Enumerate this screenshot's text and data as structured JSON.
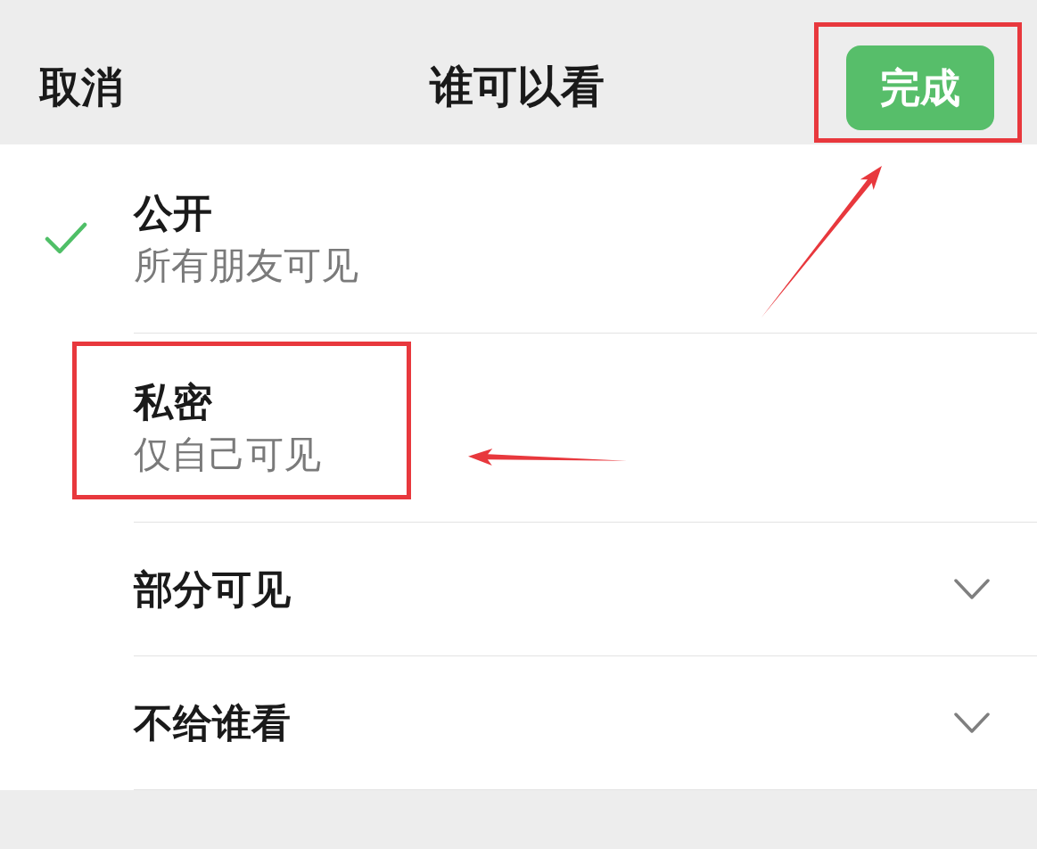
{
  "header": {
    "cancel": "取消",
    "title": "谁可以看",
    "done_button": {
      "label": "完成",
      "highlighted": true
    }
  },
  "options": [
    {
      "kind": "radio",
      "title": "公开",
      "subtitle": "所有朋友可见",
      "selected": true,
      "highlighted": false
    },
    {
      "kind": "radio",
      "title": "私密",
      "subtitle": "仅自己可见",
      "selected": false,
      "highlighted": true
    },
    {
      "kind": "expandable",
      "title": "部分可见",
      "selected": false,
      "expanded": false,
      "highlighted": false
    },
    {
      "kind": "expandable",
      "title": "不给谁看",
      "selected": false,
      "expanded": false,
      "highlighted": false
    }
  ]
}
